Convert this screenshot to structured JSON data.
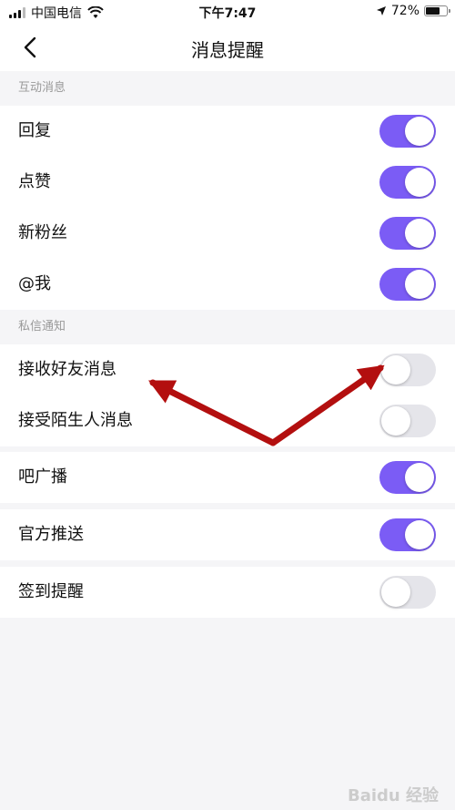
{
  "status_bar": {
    "carrier": "中国电信",
    "time": "下午7:47",
    "battery": "72%",
    "battery_level": 0.72
  },
  "nav": {
    "title": "消息提醒",
    "back_icon": "chevron-left-icon"
  },
  "sections": [
    {
      "header": "互动消息",
      "rows": [
        {
          "label": "回复",
          "on": true
        },
        {
          "label": "点赞",
          "on": true
        },
        {
          "label": "新粉丝",
          "on": true
        },
        {
          "label": "@我",
          "on": true
        }
      ]
    },
    {
      "header": "私信通知",
      "rows": [
        {
          "label": "接收好友消息",
          "on": false
        },
        {
          "label": "接受陌生人消息",
          "on": false
        }
      ]
    },
    {
      "rows": [
        {
          "label": "吧广播",
          "on": true
        }
      ]
    },
    {
      "rows": [
        {
          "label": "官方推送",
          "on": true
        }
      ]
    },
    {
      "rows": [
        {
          "label": "签到提醒",
          "on": false
        }
      ]
    }
  ],
  "colors": {
    "toggle_on": "#7b5cf5",
    "toggle_off": "#e5e5ea",
    "annotation_arrow": "#b30f0f"
  },
  "watermark": "Baidu 经验"
}
